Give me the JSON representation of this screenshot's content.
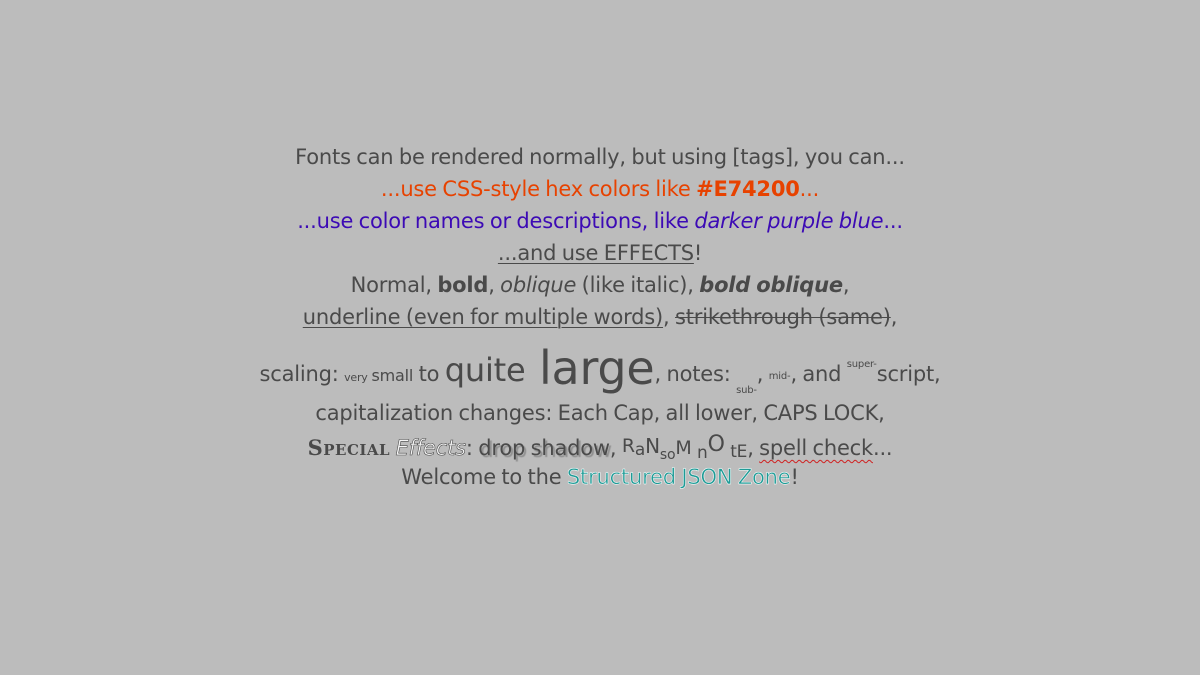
{
  "lines": {
    "l1": "Fonts can be rendered normally, but using [tags], you can...",
    "l2": {
      "a": "...use CSS-style hex colors like ",
      "hex": "#E74200",
      "b": "..."
    },
    "l3": {
      "a": "...use color names or descriptions, like ",
      "italic": "darker purple blue",
      "b": "..."
    },
    "l4": {
      "effects": "...and use EFFECTS",
      "b": "!"
    },
    "l5": {
      "normal": "Normal, ",
      "bold": "bold",
      "sep1": ", ",
      "oblique": "oblique",
      "like": " (like italic), ",
      "bold_oblique": "bold oblique",
      "end": ","
    },
    "l6": {
      "underline": "underline (even for multiple words)",
      "sep": ", ",
      "strike": "strikethrough (same)",
      "end": ","
    },
    "l7": {
      "scaling": "scaling: ",
      "very": "very",
      "small": " small",
      "to": " to ",
      "quite": "quite",
      "large": " large",
      "notes": ", notes: ",
      "sub": "sub-",
      "sep1": ", ",
      "mid": "mid-",
      "and": ", and ",
      "sup": "super-",
      "script": "script,"
    },
    "l8": "capitalization changes: Each Cap, all lower, CAPS LOCK,",
    "l9": {
      "special": "Special",
      "effects": "Effects",
      "colon": ": ",
      "shadow": "drop shadow",
      "sep": ", ",
      "ransom": [
        "R",
        "a",
        "N",
        "s",
        "o",
        "M",
        "n",
        "O",
        "t",
        "E"
      ],
      "sep2": ", ",
      "spell": "spell check",
      "end": "..."
    },
    "l10": {
      "welcome": "Welcome to the ",
      "zone": "Structured JSON Zone",
      "end": "!"
    }
  },
  "colors": {
    "background": "#bcbcbc",
    "text": "#4a4a4a",
    "hex_orange": "#E74200",
    "purple_blue": "#3c0ab5",
    "zone_teal": "#1e9b96"
  }
}
